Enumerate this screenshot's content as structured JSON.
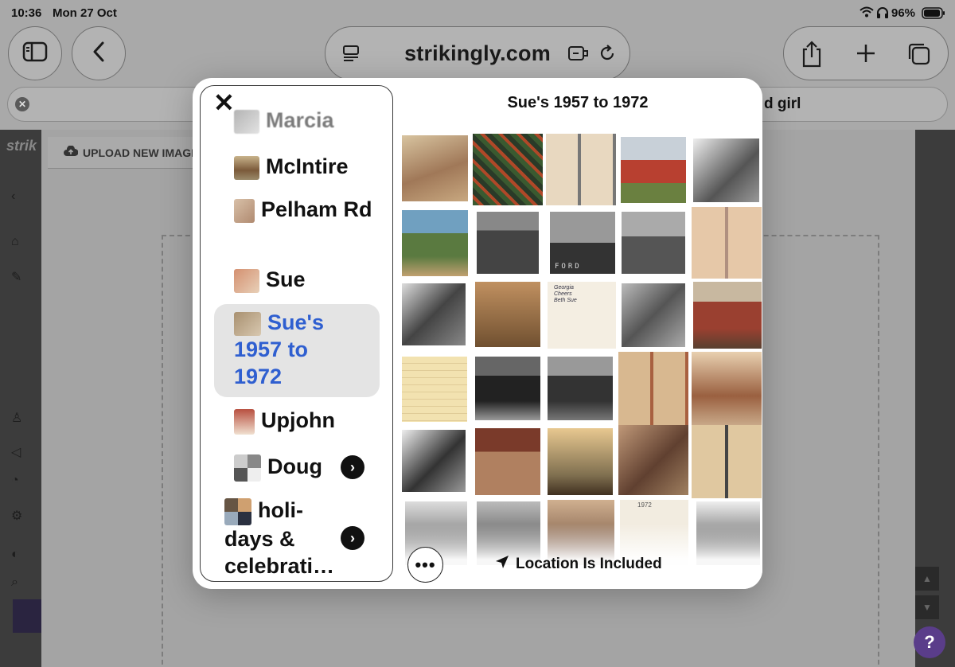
{
  "status_bar": {
    "time": "10:36",
    "date": "Mon 27 Oct",
    "battery": "96%"
  },
  "browser": {
    "address": "strikingly.com",
    "find_bar_suffix": "d girl"
  },
  "page": {
    "upload_tab": "UPLOAD NEW IMAGE",
    "brand_fragment": "strik"
  },
  "picker": {
    "title": "Sue's 1957 to 1972",
    "location_label": "Location Is Included",
    "albums": [
      {
        "label": "Marcia"
      },
      {
        "label": "McIntire"
      },
      {
        "label": "Pelham Rd"
      },
      {
        "label": "Sue"
      },
      {
        "label": "Sue's 1957 to 1972",
        "selected": true
      },
      {
        "label": "Upjohn"
      },
      {
        "label": "Doug",
        "has_submenu": true
      },
      {
        "label": "holi-days & celebrati…",
        "has_submenu": true
      }
    ],
    "photo_count_visible": 30,
    "photo_text": {
      "ford": "FORD",
      "note": "Georgia Cheers Beth Sue",
      "page_year": "1972"
    }
  },
  "help": {
    "label": "?"
  },
  "colors": {
    "accent": "#2f5fd0",
    "help": "#5a3d8a"
  }
}
